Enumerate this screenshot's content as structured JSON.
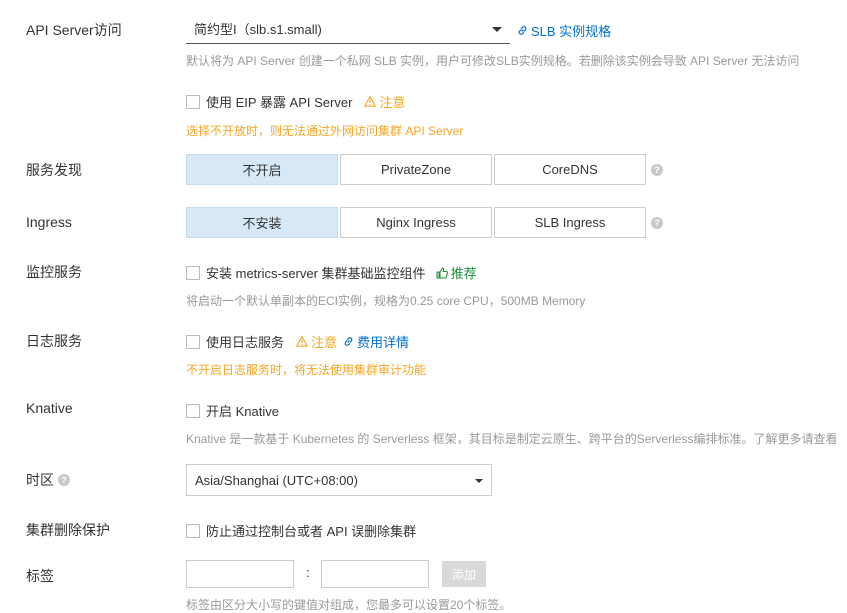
{
  "api_server": {
    "label": "API Server访问",
    "slb_value": "简约型I（slb.s1.small)",
    "slb_link": "SLB 实例规格",
    "hint": "默认将为 API Server 创建一个私网 SLB 实例，用户可修改SLB实例规格。若删除该实例会导致 API Server 无法访问",
    "eip_label": "使用 EIP 暴露 API Server",
    "eip_notice": "注意",
    "eip_warning": "选择不开放时，则无法通过外网访问集群 API Server"
  },
  "service_discovery": {
    "label": "服务发现",
    "options": [
      "不开启",
      "PrivateZone",
      "CoreDNS"
    ],
    "selected": "不开启"
  },
  "ingress": {
    "label": "Ingress",
    "options": [
      "不安装",
      "Nginx Ingress",
      "SLB Ingress"
    ],
    "selected": "不安装"
  },
  "monitoring": {
    "label": "监控服务",
    "checkbox_label": "安装 metrics-server 集群基础监控组件",
    "recommend": "推荐",
    "hint": "将启动一个默认单副本的ECI实例，规格为0.25 core CPU，500MB Memory"
  },
  "logging": {
    "label": "日志服务",
    "checkbox_label": "使用日志服务",
    "notice": "注意",
    "fee_link": "费用详情",
    "warning": "不开启日志服务时，将无法使用集群审计功能"
  },
  "knative": {
    "label": "Knative",
    "checkbox_label": "开启 Knative",
    "hint": "Knative 是一款基于 Kubernetes 的 Serverless 框架，其目标是制定云原生、跨平台的Serverless编排标准。了解更多请查看"
  },
  "timezone": {
    "label": "时区",
    "value": "Asia/Shanghai (UTC+08:00)"
  },
  "delete_protection": {
    "label": "集群删除保护",
    "checkbox_label": "防止通过控制台或者 API 误删除集群"
  },
  "tags": {
    "label": "标签",
    "separator": ":",
    "add_button": "添加",
    "hint": "标签由区分大小写的键值对组成，您最多可以设置20个标签。"
  },
  "colors": {
    "link": "#0070cc",
    "warning": "#f5a623",
    "success": "#1e8e3e",
    "selected_bg": "#d7e8f7"
  }
}
